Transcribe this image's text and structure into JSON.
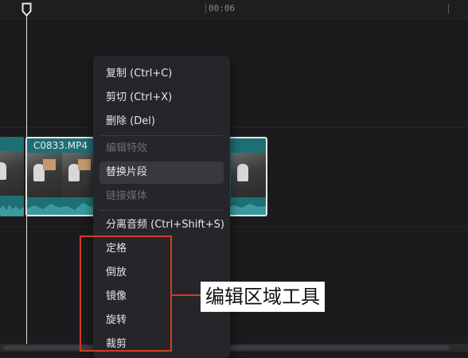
{
  "ruler": {
    "time_mark": "00:06"
  },
  "clip": {
    "filename": "C0833.MP4"
  },
  "context_menu": {
    "items": [
      {
        "label": "复制 (Ctrl+C)",
        "disabled": false
      },
      {
        "label": "剪切 (Ctrl+X)",
        "disabled": false
      },
      {
        "label": "删除 (Del)",
        "disabled": false
      },
      {
        "label": "编辑特效",
        "disabled": true
      },
      {
        "label": "替换片段",
        "disabled": false,
        "hover": true
      },
      {
        "label": "链接媒体",
        "disabled": true
      },
      {
        "label": "分离音频 (Ctrl+Shift+S)",
        "disabled": false
      },
      {
        "label": "定格",
        "disabled": false
      },
      {
        "label": "倒放",
        "disabled": false
      },
      {
        "label": "镜像",
        "disabled": false
      },
      {
        "label": "旋转",
        "disabled": false
      },
      {
        "label": "裁剪",
        "disabled": false
      }
    ]
  },
  "annotation": {
    "label": "编辑区域工具",
    "color": "#d23b26"
  },
  "colors": {
    "clip_teal": "#1e6f74",
    "menu_bg": "#26262a",
    "background": "#1b1b1d"
  }
}
